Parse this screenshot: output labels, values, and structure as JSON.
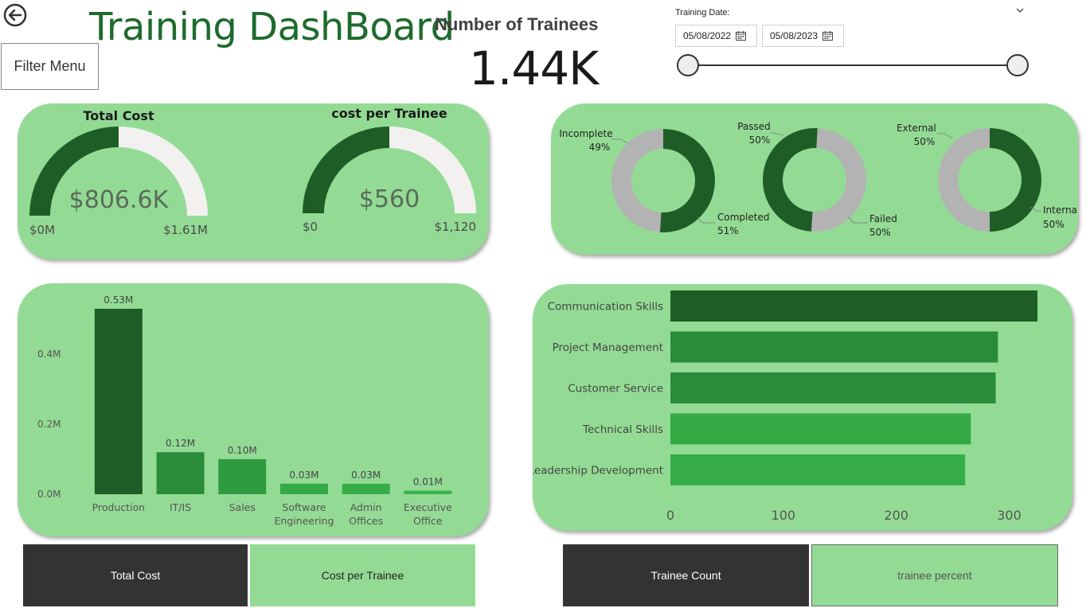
{
  "header": {
    "title": "Training DashBoard",
    "filter_button": "Filter Menu",
    "kpi": {
      "label": "Number of Trainees",
      "value": "1.44K"
    },
    "date_filter": {
      "label": "Training Date:",
      "start": "05/08/2022",
      "end": "05/08/2023",
      "range_fraction": [
        0,
        1
      ]
    }
  },
  "gauges": {
    "total_cost": {
      "title": "Total Cost",
      "value_label": "$806.6K",
      "min_label": "$0M",
      "max_label": "$1.61M",
      "fraction": 0.5
    },
    "cost_per_trainee": {
      "title": "cost per Trainee",
      "value_label": "$560",
      "min_label": "$0",
      "max_label": "$1,120",
      "fraction": 0.5
    }
  },
  "donuts": [
    {
      "name": "completion",
      "a_label": "Completed",
      "a_pct": "51%",
      "a_value": 51,
      "b_label": "Incomplete",
      "b_pct": "49%",
      "b_value": 49
    },
    {
      "name": "result",
      "a_label": "Failed",
      "a_pct": "50%",
      "a_value": 50,
      "b_label": "Passed",
      "b_pct": "50%",
      "b_value": 50
    },
    {
      "name": "type",
      "a_label": "Internal",
      "a_pct": "50%",
      "a_value": 50,
      "b_label": "External",
      "b_pct": "50%",
      "b_value": 50
    }
  ],
  "chart_data": [
    {
      "type": "bar",
      "categories": [
        [
          "Production"
        ],
        [
          "IT/IS"
        ],
        [
          "Sales"
        ],
        [
          "Software",
          "Engineering"
        ],
        [
          "Admin",
          "Offices"
        ],
        [
          "Executive",
          "Office"
        ]
      ],
      "values": [
        0.53,
        0.12,
        0.1,
        0.03,
        0.03,
        0.01
      ],
      "data_labels": [
        "0.53M",
        "0.12M",
        "0.10M",
        "0.03M",
        "0.03M",
        "0.01M"
      ],
      "y_ticks": [
        "0.0M",
        "0.2M",
        "0.4M"
      ],
      "y_tick_values": [
        0,
        0.2,
        0.4
      ],
      "ylim": [
        0,
        0.53
      ],
      "colors": [
        "#1e5e26",
        "#2a8c39",
        "#2e9b3e",
        "#34aa45",
        "#36ad47",
        "#38b049"
      ]
    },
    {
      "type": "bar",
      "orientation": "horizontal",
      "categories": [
        "Communication Skills",
        "Project Management",
        "Customer Service",
        "Technical Skills",
        "Leadership Development"
      ],
      "values": [
        325,
        290,
        288,
        266,
        261
      ],
      "x_ticks": [
        "0",
        "100",
        "200",
        "300"
      ],
      "x_tick_values": [
        0,
        100,
        200,
        300
      ],
      "xlim": [
        0,
        325
      ],
      "colors": [
        "#1e5e26",
        "#2a8c39",
        "#2a8c39",
        "#34aa45",
        "#36ad47"
      ]
    }
  ],
  "tabs": [
    {
      "label": "Total Cost"
    },
    {
      "label": "Cost per Trainee"
    },
    {
      "label": "Trainee Count"
    },
    {
      "label": "trainee percent"
    }
  ],
  "colors": {
    "dark_green": "#1e5e26",
    "card_green": "#93db94",
    "title_green": "#1e6b2d",
    "gauge_empty": "#f2f1f0",
    "donut_grey": "#b3b3b3",
    "tab_dark": "#333333"
  }
}
